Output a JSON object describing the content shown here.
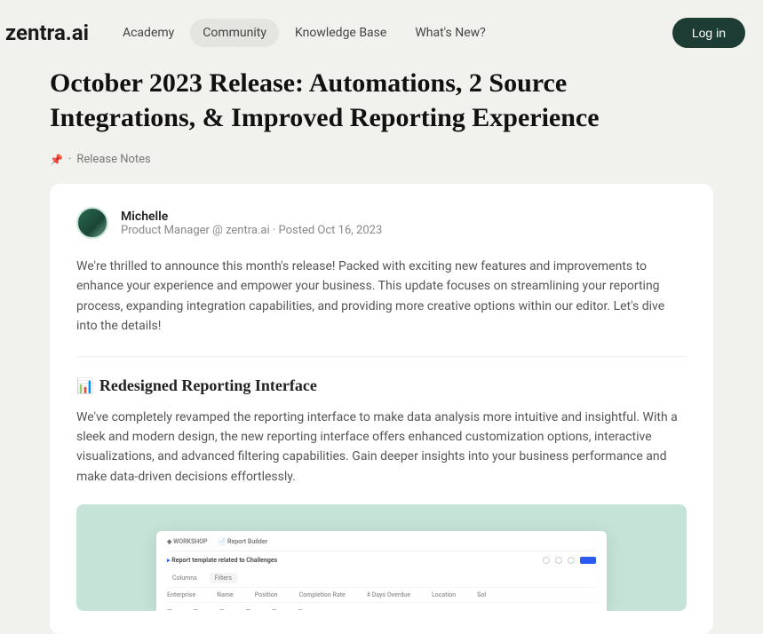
{
  "brand": "zentra.ai",
  "nav": {
    "items": [
      "Academy",
      "Community",
      "Knowledge Base",
      "What's New?"
    ]
  },
  "login": "Log in",
  "post": {
    "title": "October 2023 Release: Automations, 2 Source Integrations, & Improved Reporting Experience",
    "category": "Release Notes",
    "author": {
      "name": "Michelle",
      "subtitle": "Product Manager @ zentra.ai · Posted Oct 16, 2023"
    },
    "intro": "We're thrilled to announce this month's release! Packed with exciting new features and improvements to enhance your experience and empower your business. This update focuses on streamlining your reporting process, expanding integration capabilities, and providing more creative options within our editor. Let's dive into the details!",
    "section1": {
      "title": "Redesigned Reporting Interface",
      "body": "We've completely revamped the reporting interface to make data analysis more intuitive and insightful. With a sleek and modern design, the new reporting interface offers enhanced customization options, interactive visualizations, and advanced filtering capabilities. Gain deeper insights into your business performance and make data-driven decisions effortlessly."
    }
  },
  "mock": {
    "crumb1": "WORKSHOP",
    "crumb2": "Report Builder",
    "subtitle": "Report template related to Challenges",
    "tabs": [
      "Columns",
      "Filters"
    ],
    "headers": [
      "Enterprise",
      "Name",
      "Position",
      "Completion Rate",
      "# Days Overdue",
      "Location",
      "Sol"
    ]
  }
}
